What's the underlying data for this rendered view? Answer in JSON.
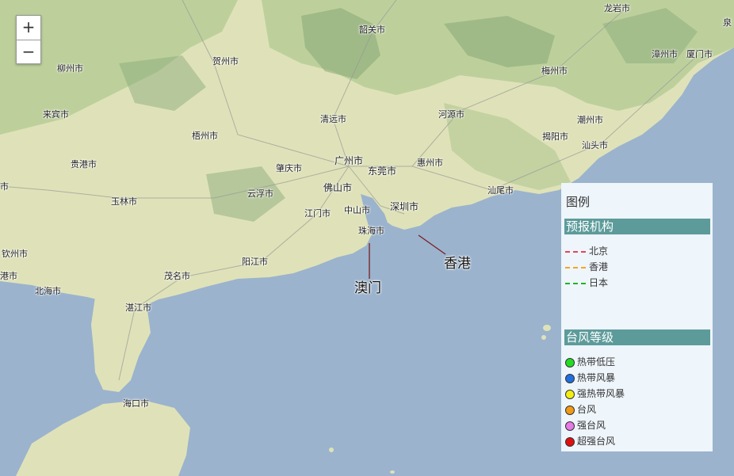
{
  "map": {
    "cities": [
      {
        "id": "longyan",
        "name": "龙岩市"
      },
      {
        "id": "shaoguan",
        "name": "韶关市"
      },
      {
        "id": "hezhou",
        "name": "贺州市"
      },
      {
        "id": "liuzhou",
        "name": "柳州市"
      },
      {
        "id": "zhangzhou",
        "name": "漳州市"
      },
      {
        "id": "xiamen",
        "name": "厦门市"
      },
      {
        "id": "quanzhou",
        "name": "泉"
      },
      {
        "id": "meizhou",
        "name": "梅州市"
      },
      {
        "id": "laibin",
        "name": "来宾市"
      },
      {
        "id": "qingyuan",
        "name": "清远市"
      },
      {
        "id": "heyuan",
        "name": "河源市"
      },
      {
        "id": "chaozhou",
        "name": "潮州市"
      },
      {
        "id": "wuzhou",
        "name": "梧州市"
      },
      {
        "id": "jieyang",
        "name": "揭阳市"
      },
      {
        "id": "shantou",
        "name": "汕头市"
      },
      {
        "id": "guiguang",
        "name": "贵港市"
      },
      {
        "id": "guangzhou",
        "name": "广州市"
      },
      {
        "id": "zhaoqing",
        "name": "肇庆市"
      },
      {
        "id": "dongguan",
        "name": "东莞市"
      },
      {
        "id": "huizhou",
        "name": "惠州市"
      },
      {
        "id": "foshan",
        "name": "佛山市"
      },
      {
        "id": "yunfu",
        "name": "云浮市"
      },
      {
        "id": "shanwei",
        "name": "汕尾市"
      },
      {
        "id": "yulin",
        "name": "玉林市"
      },
      {
        "id": "jiangmen",
        "name": "江门市"
      },
      {
        "id": "zhongshan",
        "name": "中山市"
      },
      {
        "id": "shenzhen",
        "name": "深圳市"
      },
      {
        "id": "zhuhai",
        "name": "珠海市"
      },
      {
        "id": "qinzhou",
        "name": "钦州市"
      },
      {
        "id": "yangjiang",
        "name": "阳江市"
      },
      {
        "id": "maoming",
        "name": "茂名市"
      },
      {
        "id": "beihai",
        "name": "北海市"
      },
      {
        "id": "zhanjiang",
        "name": "湛江市"
      },
      {
        "id": "haikou",
        "name": "海口市"
      },
      {
        "id": "nanning_partial",
        "name": "市"
      },
      {
        "id": "fangcheng_partial",
        "name": "港市"
      }
    ],
    "callouts": {
      "hongkong": "香港",
      "macau": "澳门"
    }
  },
  "zoom": {
    "in": "+",
    "out": "−"
  },
  "legend": {
    "title": "图例",
    "agency_header": "预报机构",
    "agencies": [
      {
        "label": "北京",
        "color": "#e8435a"
      },
      {
        "label": "香港",
        "color": "#f5a623"
      },
      {
        "label": "日本",
        "color": "#22b422"
      }
    ],
    "level_header": "台风等级",
    "levels": [
      {
        "label": "热带低压",
        "color": "#22dd22"
      },
      {
        "label": "热带风暴",
        "color": "#1f6fe0"
      },
      {
        "label": "强热带风暴",
        "color": "#f3ee12"
      },
      {
        "label": "台风",
        "color": "#f09a16"
      },
      {
        "label": "强台风",
        "color": "#e67ae6"
      },
      {
        "label": "超强台风",
        "color": "#e01010"
      }
    ]
  },
  "colors": {
    "sea": "#9bb3cd",
    "land": "#dfe2b8",
    "land_green": "#b7cc96",
    "mountain": "#86a877"
  }
}
